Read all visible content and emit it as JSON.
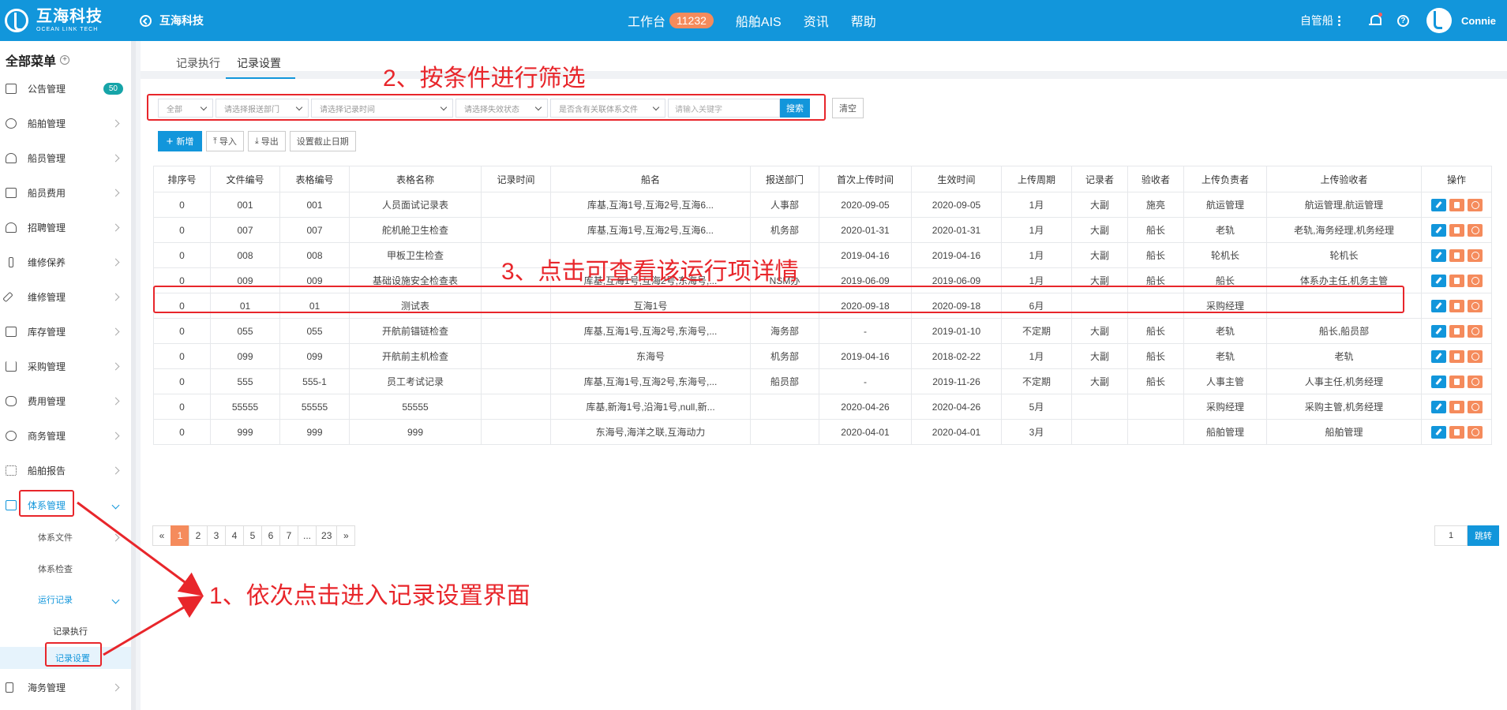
{
  "topbar": {
    "logo_cn": "互海科技",
    "logo_en": "OCEAN LINK TECH",
    "back_label": "互海科技",
    "nav": [
      {
        "label": "工作台",
        "badge": "11232"
      },
      {
        "label": "船舶AIS"
      },
      {
        "label": "资讯"
      },
      {
        "label": "帮助"
      }
    ],
    "ship_select": "自管船",
    "username": "Connie",
    "help_glyph": "?"
  },
  "sidebar": {
    "title": "全部菜单",
    "items": [
      {
        "label": "公告管理",
        "badge": "50"
      },
      {
        "label": "船舶管理"
      },
      {
        "label": "船员管理"
      },
      {
        "label": "船员费用"
      },
      {
        "label": "招聘管理"
      },
      {
        "label": "维修保养"
      },
      {
        "label": "维修管理"
      },
      {
        "label": "库存管理"
      },
      {
        "label": "采购管理"
      },
      {
        "label": "费用管理"
      },
      {
        "label": "商务管理"
      },
      {
        "label": "船舶报告"
      },
      {
        "label": "体系管理"
      },
      {
        "label": "海务管理"
      }
    ],
    "sub": {
      "tixi_wenjian": "体系文件",
      "tixi_jiancha": "体系检查",
      "yunxing_jilu": "运行记录",
      "jilu_zhixing": "记录执行",
      "jilu_shezhi": "记录设置"
    }
  },
  "tabs": [
    "记录执行",
    "记录设置"
  ],
  "filters": {
    "all": "全部",
    "dept_placeholder": "请选择报送部门",
    "time_placeholder": "请选择记录时间",
    "status_placeholder": "请选择失效状态",
    "file_placeholder": "是否含有关联体系文件",
    "keyword_placeholder": "请输入关键字",
    "search": "搜索",
    "clear": "清空"
  },
  "actions": {
    "add": "新增",
    "import": "导入",
    "export": "导出",
    "deadline": "设置截止日期"
  },
  "table": {
    "headers": [
      "排序号",
      "文件编号",
      "表格编号",
      "表格名称",
      "记录时间",
      "船名",
      "报送部门",
      "首次上传时间",
      "生效时间",
      "上传周期",
      "记录者",
      "验收者",
      "上传负责者",
      "上传验收者",
      "操作"
    ],
    "rows": [
      [
        "0",
        "001",
        "001",
        "人员面试记录表",
        "",
        "库基,互海1号,互海2号,互海6...",
        "人事部",
        "2020-09-05",
        "2020-09-05",
        "1月",
        "大副",
        "施亮",
        "航运管理",
        "航运管理,航运管理"
      ],
      [
        "0",
        "007",
        "007",
        "舵机舱卫生检查",
        "",
        "库基,互海1号,互海2号,互海6...",
        "机务部",
        "2020-01-31",
        "2020-01-31",
        "1月",
        "大副",
        "船长",
        "老轨",
        "老轨,海务经理,机务经理"
      ],
      [
        "0",
        "008",
        "008",
        "甲板卫生检查",
        "",
        "",
        "",
        "2019-04-16",
        "2019-04-16",
        "1月",
        "大副",
        "船长",
        "轮机长",
        "轮机长"
      ],
      [
        "0",
        "009",
        "009",
        "基础设施安全检查表",
        "",
        "库基,互海1号,互海2号,东海号,...",
        "NSM办",
        "2019-06-09",
        "2019-06-09",
        "1月",
        "大副",
        "船长",
        "船长",
        "体系办主任,机务主管"
      ],
      [
        "0",
        "01",
        "01",
        "测试表",
        "",
        "互海1号",
        "",
        "2020-09-18",
        "2020-09-18",
        "6月",
        "",
        "",
        "采购经理",
        ""
      ],
      [
        "0",
        "055",
        "055",
        "开航前锚链检查",
        "",
        "库基,互海1号,互海2号,东海号,...",
        "海务部",
        "-",
        "2019-01-10",
        "不定期",
        "大副",
        "船长",
        "老轨",
        "船长,船员部"
      ],
      [
        "0",
        "099",
        "099",
        "开航前主机检查",
        "",
        "东海号",
        "机务部",
        "2019-04-16",
        "2018-02-22",
        "1月",
        "大副",
        "船长",
        "老轨",
        "老轨"
      ],
      [
        "0",
        "555",
        "555-1",
        "员工考试记录",
        "",
        "库基,互海1号,互海2号,东海号,...",
        "船员部",
        "-",
        "2019-11-26",
        "不定期",
        "大副",
        "船长",
        "人事主管",
        "人事主任,机务经理"
      ],
      [
        "0",
        "55555",
        "55555",
        "55555",
        "",
        "库基,新海1号,沿海1号,null,新...",
        "",
        "2020-04-26",
        "2020-04-26",
        "5月",
        "",
        "",
        "采购经理",
        "采购主管,机务经理"
      ],
      [
        "0",
        "999",
        "999",
        "999",
        "",
        "东海号,海洋之联,互海动力",
        "",
        "2020-04-01",
        "2020-04-01",
        "3月",
        "",
        "",
        "船舶管理",
        "船舶管理"
      ]
    ]
  },
  "pagination": {
    "prev": "«",
    "pages": [
      "1",
      "2",
      "3",
      "4",
      "5",
      "6",
      "7",
      "...",
      "23"
    ],
    "next": "»",
    "current": "1",
    "jump_value": "1",
    "jump_label": "跳转"
  },
  "annotations": {
    "step1": "1、依次点击进入记录设置界面",
    "step2": "2、按条件进行筛选",
    "step3": "3、点击可查看该运行项详情"
  },
  "colors": {
    "primary": "#1296db",
    "accent": "#f58b5c",
    "annotation": "#e8262b"
  }
}
